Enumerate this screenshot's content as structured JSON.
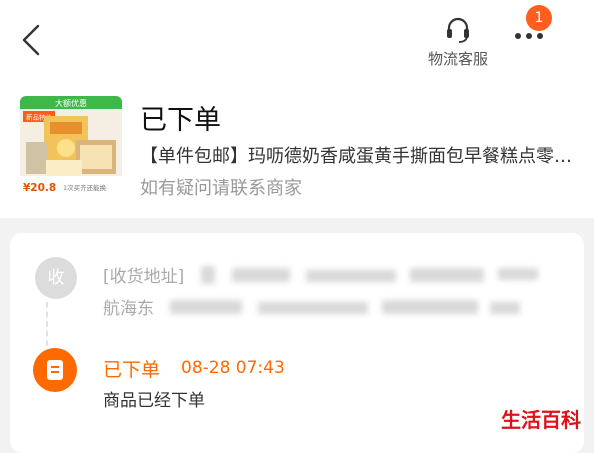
{
  "header": {
    "back_icon": "chevron-left-icon",
    "customer_service": {
      "icon": "headset-icon",
      "label": "物流客服"
    },
    "more_icon": "more-dots-icon",
    "notification_count": "1"
  },
  "order": {
    "title": "已下单",
    "product_name": "【单件包邮】玛呖德奶香咸蛋黄手撕面包早餐糕点零食整箱",
    "contact_note": "如有疑问请联系商家",
    "thumbnail": {
      "badge_top": "大额优惠",
      "tag": "新品特价",
      "price": "¥20.8",
      "caption": "1次买齐还能换"
    }
  },
  "timeline": {
    "address": {
      "node_label": "收",
      "label": "[收货地址]",
      "prefix": "航海东"
    },
    "status": {
      "node_icon": "order-list-icon",
      "title": "已下单",
      "time": "08-28 07:43",
      "description": "商品已经下单"
    }
  },
  "watermark": "生活百科",
  "colors": {
    "accent": "#ff6a00",
    "badge": "#ff5e1f",
    "watermark": "#e0101a"
  }
}
